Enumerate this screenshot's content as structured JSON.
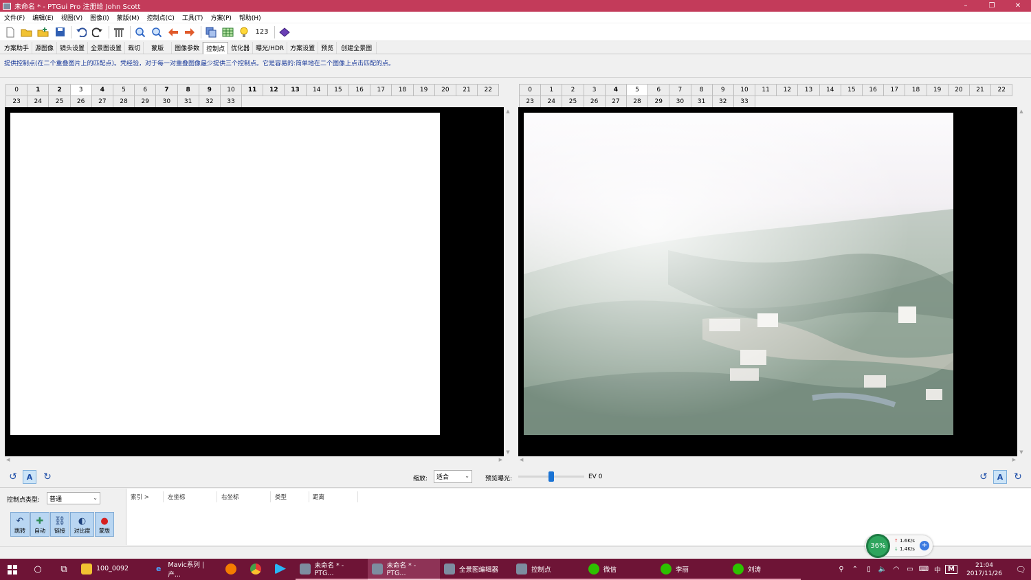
{
  "window": {
    "title": "未命名 * - PTGui Pro 注册给 John Scott",
    "controls": [
      "–",
      "❐",
      "✕"
    ]
  },
  "menu": [
    "文件(F)",
    "编辑(E)",
    "视图(V)",
    "图像(I)",
    "蒙版(M)",
    "控制点(C)",
    "工具(T)",
    "方案(P)",
    "帮助(H)"
  ],
  "toolbar": {
    "counter_label": "123",
    "icons": [
      "new-file-icon",
      "open-folder-icon",
      "add-images-icon",
      "save-icon",
      "undo-icon",
      "redo-icon",
      "panorama-settings-icon",
      "zoom-in-icon",
      "zoom-out-icon",
      "arrow-left-icon",
      "arrow-right-icon",
      "copy-images-icon",
      "table-icon",
      "bulb-icon",
      "numbering-icon",
      "publish-icon"
    ]
  },
  "tabs": [
    "方案助手",
    "源图像",
    "镜头设置",
    "全景图设置",
    "裁切",
    "蒙版",
    "图像参数",
    "控制点",
    "优化器",
    "曝光/HDR",
    "方案设置",
    "预览",
    "创建全景图"
  ],
  "active_tab": "控制点",
  "hint": "提供控制点(在二个重叠图片上的匹配点)。凭经验，对于每一对重叠图像最少提供三个控制点。它是容易的:简单地在二个图像上点击匹配的点。",
  "left_panel": {
    "numbers": [
      "0",
      "1",
      "2",
      "3",
      "4",
      "5",
      "6",
      "7",
      "8",
      "9",
      "10",
      "11",
      "12",
      "13",
      "14",
      "15",
      "16",
      "17",
      "18",
      "19",
      "20",
      "21",
      "22",
      "23",
      "24",
      "25",
      "26",
      "27",
      "28",
      "29",
      "30",
      "31",
      "32",
      "33"
    ],
    "bold": [
      "1",
      "2",
      "4",
      "7",
      "8",
      "9",
      "11",
      "12",
      "13"
    ],
    "selected": "3"
  },
  "right_panel": {
    "numbers": [
      "0",
      "1",
      "2",
      "3",
      "4",
      "5",
      "6",
      "7",
      "8",
      "9",
      "10",
      "11",
      "12",
      "13",
      "14",
      "15",
      "16",
      "17",
      "18",
      "19",
      "20",
      "21",
      "22",
      "23",
      "24",
      "25",
      "26",
      "27",
      "28",
      "29",
      "30",
      "31",
      "32",
      "33"
    ],
    "bold": [
      "4"
    ],
    "selected": "5"
  },
  "view_controls": {
    "zoom_label": "缩放:",
    "zoom_value": "适合",
    "exposure_label": "预览曝光:",
    "ev_value": "EV 0",
    "ev_position": 0.5,
    "mode_button": "A"
  },
  "bottom": {
    "cp_type_label": "控制点类型:",
    "cp_type_value": "普通",
    "buttons": [
      {
        "label": "跳转",
        "icon": "↶"
      },
      {
        "label": "自动",
        "icon": "✚"
      },
      {
        "label": "链接",
        "icon": "⛓"
      },
      {
        "label": "对比度",
        "icon": "◐"
      },
      {
        "label": "蒙版",
        "icon": "●"
      }
    ],
    "columns": [
      "索引 >",
      "左坐标",
      "右坐标",
      "类型",
      "距离"
    ]
  },
  "net_widget": {
    "percent": "36%",
    "up": "1.6K/s",
    "down": "1.4K/s"
  },
  "taskbar": {
    "tasks": [
      {
        "label": "100_0092",
        "icon": "folder-icon"
      },
      {
        "label": "Mavic系列 | 产...",
        "icon": "edge-icon"
      },
      {
        "label": "",
        "icon": "firefox-icon"
      },
      {
        "label": "",
        "icon": "chrome-like-icon"
      },
      {
        "label": "",
        "icon": "play-icon"
      },
      {
        "label": "未命名 * - PTG...",
        "icon": "ptgui-icon"
      },
      {
        "label": "未命名 * - PTG...",
        "icon": "ptgui-icon",
        "active": true
      },
      {
        "label": "全景图编辑器",
        "icon": "ptgui-icon"
      },
      {
        "label": "控制点",
        "icon": "ptgui-icon"
      },
      {
        "label": "微信",
        "icon": "wechat-icon"
      },
      {
        "label": "李丽",
        "icon": "wechat-icon"
      },
      {
        "label": "刘涛",
        "icon": "wechat-icon"
      }
    ],
    "tray": {
      "ime": "中",
      "ime2": "M",
      "time": "21:04",
      "date": "2017/11/26"
    }
  },
  "colors": {
    "titlebar": "#c33b5a",
    "taskbar": "#6e1436",
    "hint": "#1a3a9a",
    "accent": "#1a73d4"
  }
}
